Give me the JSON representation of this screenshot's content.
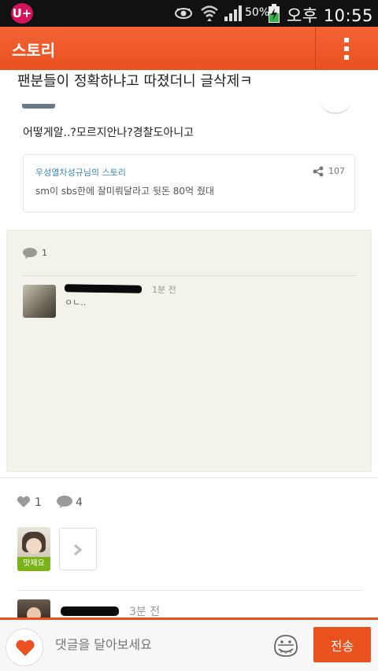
{
  "status_bar": {
    "carrier_logo": "U+",
    "battery_percent": "50%",
    "time": "오후 10:55",
    "icons": [
      "eye-icon",
      "wifi-icon",
      "signal-icon",
      "battery-charging-icon"
    ]
  },
  "app_bar": {
    "title": "스토리",
    "menu_icon": "overflow-menu-icon"
  },
  "post": {
    "text": "팬분들이 정확하냐고 따졌더니 글삭제ㅋ",
    "comment_text": "어떻게알..?모르지안나?경찰도아니고"
  },
  "share_card": {
    "author": "우성열차성규님의 스토리",
    "summary": "sm이 sbs한에 잘미뤄달라고 뒷돈 80억 줬대",
    "share_count": "107"
  },
  "comments_box": {
    "comment_count": "1",
    "comments": [
      {
        "time": "1분 전",
        "text": "ㅇㄴ.."
      }
    ]
  },
  "stats": {
    "like_count": "1",
    "comment_count": "4"
  },
  "friends": {
    "tag": "맛제요"
  },
  "recent_comment": {
    "time": "3분 전"
  },
  "input_bar": {
    "placeholder": "댓글을 달아보세요",
    "send_label": "전송"
  },
  "colors": {
    "accent": "#e9521f",
    "status_bar": "#111111",
    "link": "#3a88b0",
    "friend_tag": "#7ab318"
  }
}
